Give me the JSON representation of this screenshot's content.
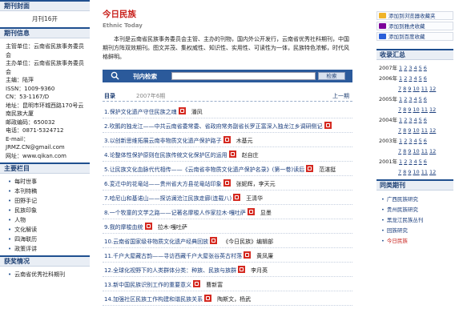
{
  "left": {
    "cover_title": "期刊封面",
    "cover_caption": "月刊16开",
    "info_title": "期刊信息",
    "info_lines": [
      "主管单位：云南省民族事务委员会",
      "主办单位：云南省民族事务委员会",
      "主编：陆萍",
      "ISSN：1009-9360",
      "CN：53-1167/D",
      "地址：昆明市环城西路170号云南民族大厦",
      "邮政编码：650032",
      "电话：0871-5324712",
      "E-mail：JRMZ.CN@gmail.com",
      "网址：www.qikan.com"
    ],
    "menu_title": "主要栏目",
    "menu_items": [
      "每时世事",
      "本刊特稿",
      "田野手记",
      "民族印象",
      "人物",
      "文化解读",
      "四海联历",
      "政策评讲"
    ],
    "award_title": "获奖情况",
    "award_item": "云南省优秀社科期刊"
  },
  "center": {
    "title": "今日民族",
    "subtitle": "Ethnic Today",
    "intro": "本刊是云南省民族事务委员会主管、主办的刊物，国内外公开发行，云南省优秀社科期刊，中国期刊方阵双效期刊。图文并茂、集权威性、知识性、实用性、可读性为一体，民族特色浓郁，时代风格鲜明。",
    "search_label": "刊内检索",
    "search_value": "",
    "search_button": "检索",
    "toc_label": "目录",
    "toc_issue": "2007年6期",
    "toc_prev": "上一期",
    "articles": [
      {
        "n": "1.",
        "title": "保护文化遗产守住民族之魂",
        "author": "潘凤"
      },
      {
        "n": "2.",
        "title": "吹鹅的独龙江——中共云南省委常委、省政府常务副省长罗正富深入独龙江乡调研侧记",
        "author": ""
      },
      {
        "n": "3.",
        "title": "以创新思维拓展云南非物质文化遗产保护路子",
        "author": "木基元"
      },
      {
        "n": "4.",
        "title": "论整体性保护原则在民族传统文化保护区的运用",
        "author": "赵自庄"
      },
      {
        "n": "5.",
        "title": "让民族文化血脉代代相传——《云南省非物质文化遗产保护名录》(第一卷)读后",
        "author": "范湛挺"
      },
      {
        "n": "6.",
        "title": "変迁中的花竜站——贵州省大方县花竜站印象",
        "author": "张妮辉，李天元"
      },
      {
        "n": "7.",
        "title": "哈尼山和基诺山——探访澜沧江民族走廊(连载八)",
        "author": "王清华"
      },
      {
        "n": "8.",
        "title": "一个牧童的文学之路——记著名摩梭人作家拉木·嘎吐萨",
        "author": "显墨"
      },
      {
        "n": "9.",
        "title": "我的摩梭血统",
        "author": "拉木·嘎吐萨"
      },
      {
        "n": "10.",
        "title": "云南省国家级非物质文化遗产经典回放",
        "author": "《今日民族》编辑部"
      },
      {
        "n": "11.",
        "title": "千户大屋藏古韵——寻访西藏千户大屋张谷英古村落",
        "author": "黄凤廉"
      },
      {
        "n": "12.",
        "title": "全球化视野下的人类群体分类：种族、民族与族群",
        "author": "李月英"
      },
      {
        "n": "13.",
        "title": "新中国民族识别工作的重要意义",
        "author": "曹新富"
      },
      {
        "n": "14.",
        "title": "加强社区民族工作构建和谐民族关系",
        "author": "陶斯文，杨武"
      }
    ]
  },
  "right": {
    "btn_collect": "添加到浏览器收藏夹",
    "btn_yahoo": "添加到雅虎收藏",
    "btn_baidu": "添加到百度收藏",
    "archive_title": "收录汇总",
    "years": [
      {
        "y": "2007年",
        "m": [
          "1",
          "2",
          "3",
          "4",
          "5",
          "6"
        ]
      },
      {
        "y": "2006年",
        "m": [
          "1",
          "2",
          "3",
          "4",
          "5",
          "6"
        ]
      },
      {
        "y": "",
        "m": [
          "7",
          "8",
          "9",
          "10",
          "11",
          "12"
        ]
      },
      {
        "y": "2005年",
        "m": [
          "1",
          "2",
          "3",
          "4",
          "5",
          "6"
        ]
      },
      {
        "y": "",
        "m": [
          "7",
          "8",
          "9",
          "10",
          "11",
          "12"
        ]
      },
      {
        "y": "2004年",
        "m": [
          "1",
          "2",
          "3",
          "4",
          "5",
          "6"
        ]
      },
      {
        "y": "",
        "m": [
          "7",
          "8",
          "9",
          "10",
          "11",
          "12"
        ]
      },
      {
        "y": "2003年",
        "m": [
          "1",
          "2",
          "3",
          "4",
          "5",
          "6"
        ]
      },
      {
        "y": "",
        "m": [
          "7",
          "8",
          "9",
          "10",
          "11",
          "12"
        ]
      },
      {
        "y": "2001年",
        "m": [
          "1",
          "2",
          "3",
          "4",
          "5",
          "6"
        ]
      },
      {
        "y": "",
        "m": [
          "7",
          "8",
          "9",
          "10",
          "11",
          "12"
        ]
      }
    ],
    "same_title": "同类期刊",
    "same_items": [
      "广西民族研究",
      "贵州民族研究",
      "黑龙江民族丛刊",
      "回族研究",
      "今日民族"
    ],
    "same_current": 4
  },
  "colors": {
    "accent": "#1f4f8f",
    "title_red": "#c8201b",
    "pdf_red": "#d52920"
  }
}
